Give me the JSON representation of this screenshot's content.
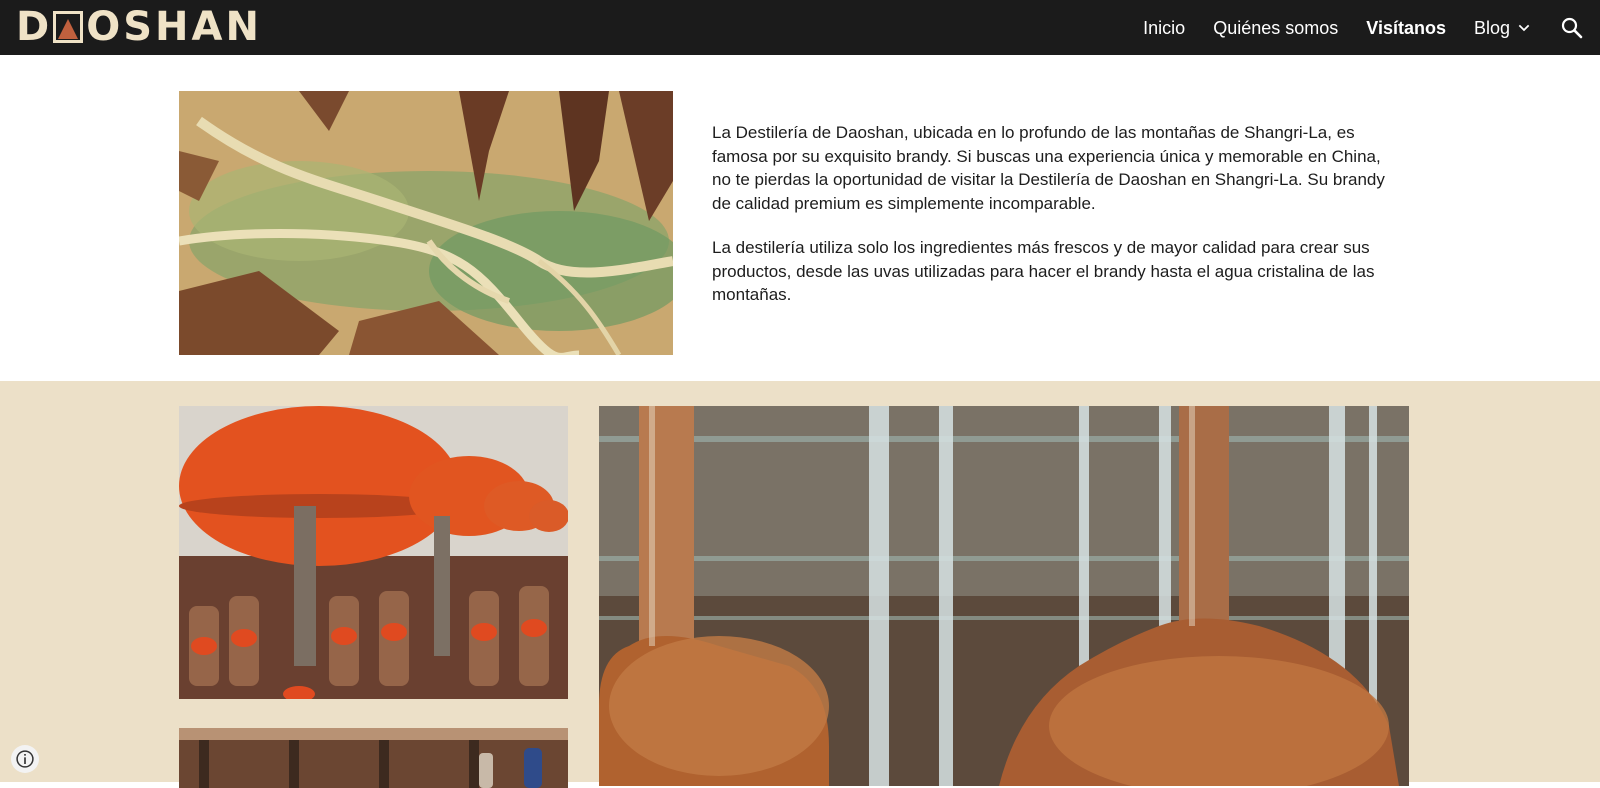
{
  "header": {
    "logo_prefix": "D",
    "logo_suffix": "OSHAN",
    "nav": [
      {
        "label": "Inicio",
        "active": false
      },
      {
        "label": "Quiénes somos",
        "active": false
      },
      {
        "label": "Visítanos",
        "active": true
      },
      {
        "label": "Blog",
        "active": false,
        "has_dropdown": true
      }
    ],
    "search_icon": "search-icon",
    "dropdown_icon": "chevron-down-icon"
  },
  "intro": {
    "paragraphs": [
      "La Destilería de Daoshan, ubicada en lo profundo de las montañas de Shangri-La, es famosa por su exquisito brandy. Si buscas una experiencia única y memorable en China, no te pierdas la oportunidad de visitar la Destilería de Daoshan en Shangri-La. Su brandy de calidad premium es simplemente incomparable.",
      "La destilería utiliza solo los ingredientes más frescos y de mayor calidad para crear sus productos, desde las uvas utilizadas para hacer el brandy hasta el agua cristalina de las montañas."
    ]
  },
  "colors": {
    "header_bg": "#1b1b1b",
    "logo": "#efe2c6",
    "logo_accent": "#c0603e",
    "gallery_bg": "#ece0c8"
  },
  "footer": {
    "info_icon": "info-icon"
  }
}
